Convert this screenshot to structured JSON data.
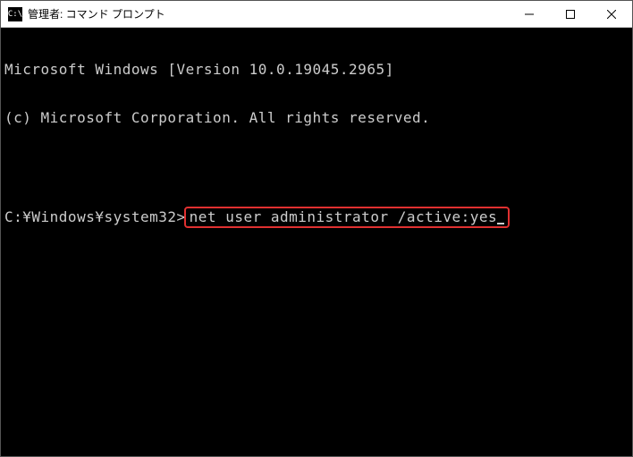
{
  "window": {
    "title": "管理者: コマンド プロンプト",
    "icon_label": "C:\\"
  },
  "terminal": {
    "line1": "Microsoft Windows [Version 10.0.19045.2965]",
    "line2": "(c) Microsoft Corporation. All rights reserved.",
    "prompt": "C:¥Windows¥system32>",
    "command": "net user administrator /active:yes"
  }
}
